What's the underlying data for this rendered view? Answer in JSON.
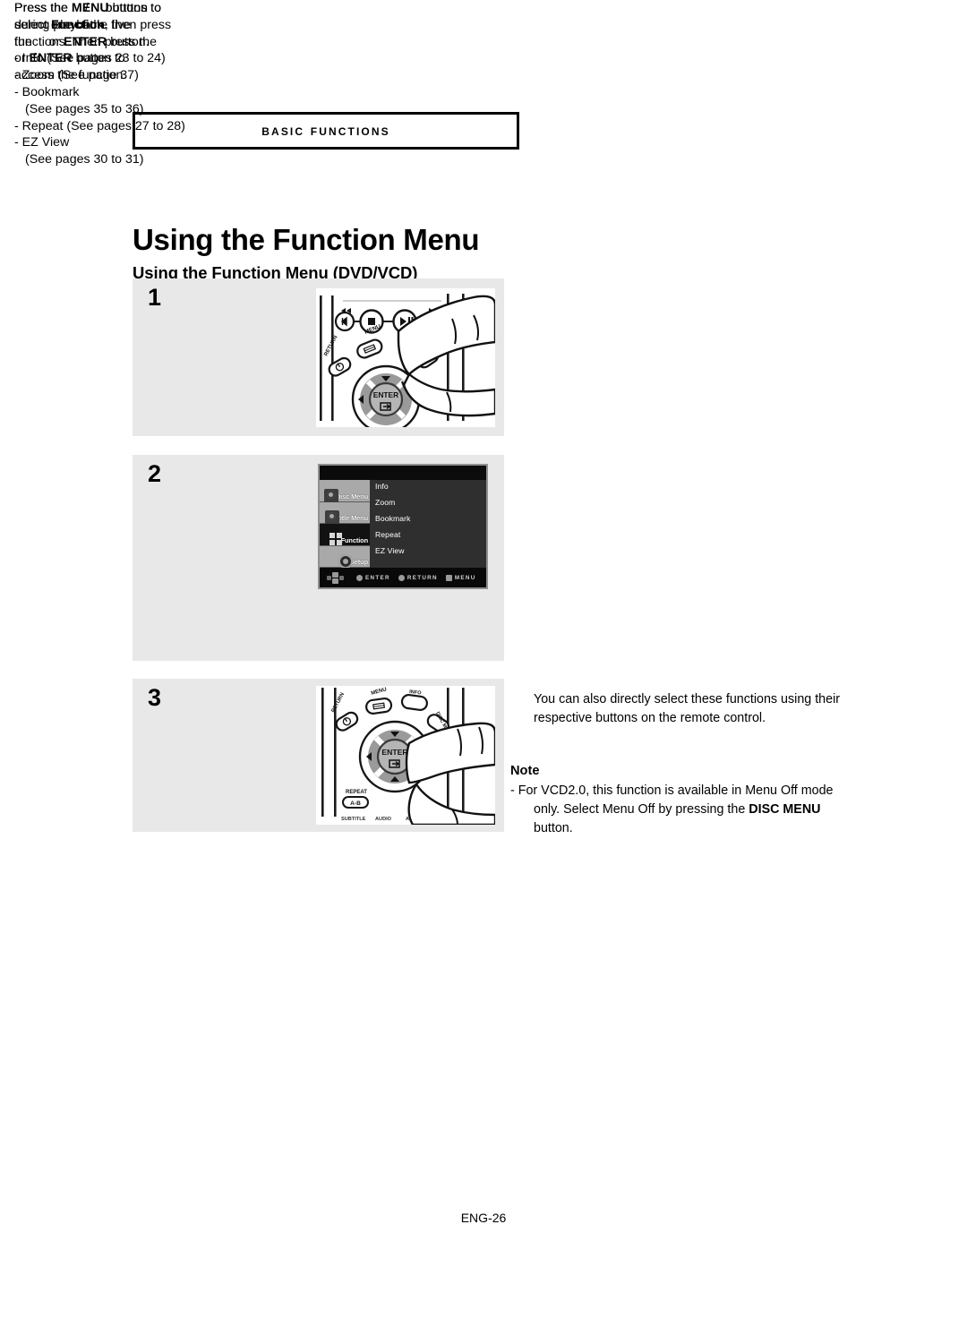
{
  "chapter": {
    "label": "Basic Functions"
  },
  "titles": {
    "main": "Using the Function Menu",
    "sub": "Using the Function Menu (DVD/VCD)"
  },
  "steps": [
    {
      "number": "1",
      "lines": [
        {
          "type": "rich",
          "parts": [
            {
              "text": "Press the ",
              "bold": false
            },
            {
              "text": "MENU",
              "bold": true
            },
            {
              "text": " button",
              "bold": false
            }
          ]
        },
        {
          "type": "plain",
          "text": "during playback."
        }
      ]
    },
    {
      "number": "2",
      "lines": [
        {
          "type": "rich",
          "parts": [
            {
              "text": "Press the ",
              "bold": false
            },
            {
              "text": "ARROWS",
              "bold": false
            },
            {
              "text": " buttons to",
              "bold": false
            }
          ]
        },
        {
          "type": "rich",
          "parts": [
            {
              "text": "select ",
              "bold": false
            },
            {
              "text": "Function",
              "bold": true
            },
            {
              "text": ", then press",
              "bold": false
            }
          ]
        },
        {
          "type": "rich",
          "parts": [
            {
              "text": "the ",
              "bold": false
            },
            {
              "text": "ARROW",
              "bold": false
            },
            {
              "text": " or ",
              "bold": false
            },
            {
              "text": "ENTER",
              "bold": true
            },
            {
              "text": " button.",
              "bold": false
            }
          ]
        }
      ],
      "bullets": [
        {
          "text": "Info (See pages 23 to 24)"
        },
        {
          "text": "Zoom (See page 37)"
        },
        {
          "text": "Bookmark",
          "cont": "(See pages 35 to 36)"
        },
        {
          "text": "Repeat (See pages 27 to 28)"
        },
        {
          "text": "EZ View",
          "cont": "(See pages 30 to 31)"
        }
      ]
    },
    {
      "number": "3",
      "lines": [
        {
          "type": "rich",
          "parts": [
            {
              "text": "Press the ",
              "bold": false
            },
            {
              "text": "ARROWS",
              "bold": false
            },
            {
              "text": " buttons to",
              "bold": false
            }
          ]
        },
        {
          "type": "plain",
          "text": "select one of the five"
        },
        {
          "type": "plain",
          "text": "functions. Then press the"
        },
        {
          "type": "rich",
          "parts": [
            {
              "text": "   or ",
              "bold": false
            },
            {
              "text": "ENTER",
              "bold": true
            },
            {
              "text": " button to",
              "bold": false
            }
          ]
        },
        {
          "type": "plain",
          "text": "access the function."
        }
      ]
    }
  ],
  "osd_menu": {
    "sidebar": [
      {
        "label": "Disc Menu",
        "icon": "disc-menu-icon",
        "selected": false
      },
      {
        "label": "Title Menu",
        "icon": "title-menu-icon",
        "selected": false
      },
      {
        "label": "Function",
        "icon": "function-icon",
        "selected": true
      },
      {
        "label": "Setup",
        "icon": "setup-gear-icon",
        "selected": false
      }
    ],
    "items": [
      "Info",
      "Zoom",
      "Bookmark",
      "Repeat",
      "EZ View"
    ],
    "footer_hints": [
      {
        "label": "ENTER",
        "glyph": "circle"
      },
      {
        "label": "RETURN",
        "glyph": "circle"
      },
      {
        "label": "MENU",
        "glyph": "square"
      }
    ]
  },
  "remote_labels": {
    "menu": "MENU",
    "return": "RETURN",
    "disc_menu": "DISC MENU",
    "enter": "ENTER",
    "repeat": "REPEAT",
    "repeat_ab": "A-B",
    "subtitle": "SUBTITLE",
    "audio": "AUDIO",
    "angle": "ANGLE"
  },
  "side_note": "You can also directly select these functions using their respective buttons on the remote control.",
  "note": {
    "heading": "Note",
    "dash": "-",
    "parts": [
      {
        "text": "For VCD2.0, this function is available in Menu Off mode only. Select Menu Off by pressing the ",
        "bold": false
      },
      {
        "text": "DISC MENU",
        "bold": true
      },
      {
        "text": " button.",
        "bold": false
      }
    ]
  },
  "footer": {
    "page": "ENG-26"
  },
  "colors": {
    "panel_bg": "#e8e8e8",
    "osd_bg": "#2f2f2f",
    "osd_selected": "#121212",
    "osd_sidebar": "#a9a9a9"
  }
}
